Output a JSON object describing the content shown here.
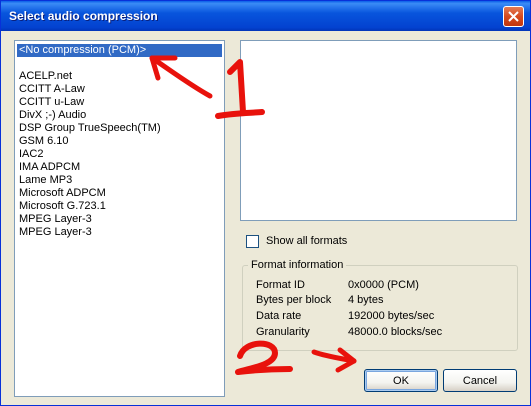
{
  "window": {
    "title": "Select audio compression"
  },
  "codecs": {
    "selected": "<No compression (PCM)>",
    "items": [
      "ACELP.net",
      "CCITT A-Law",
      "CCITT u-Law",
      "DivX ;-) Audio",
      "DSP Group TrueSpeech(TM)",
      "GSM 6.10",
      "IAC2",
      "IMA ADPCM",
      "Lame MP3",
      "Microsoft ADPCM",
      "Microsoft G.723.1",
      "MPEG Layer-3",
      "MPEG Layer-3"
    ]
  },
  "show_all_formats": {
    "label": "Show all formats",
    "checked": false
  },
  "format_info": {
    "title": "Format information",
    "rows": [
      {
        "label": "Format ID",
        "value": "0x0000 (PCM)"
      },
      {
        "label": "Bytes per block",
        "value": "4 bytes"
      },
      {
        "label": "Data rate",
        "value": "192000 bytes/sec"
      },
      {
        "label": "Granularity",
        "value": "48000.0 blocks/sec"
      }
    ]
  },
  "buttons": {
    "ok": "OK",
    "cancel": "Cancel"
  },
  "annotations": {
    "mark_1": "1",
    "mark_2": "2",
    "color": "#e8120c"
  },
  "icons": {
    "close": "close-icon"
  }
}
